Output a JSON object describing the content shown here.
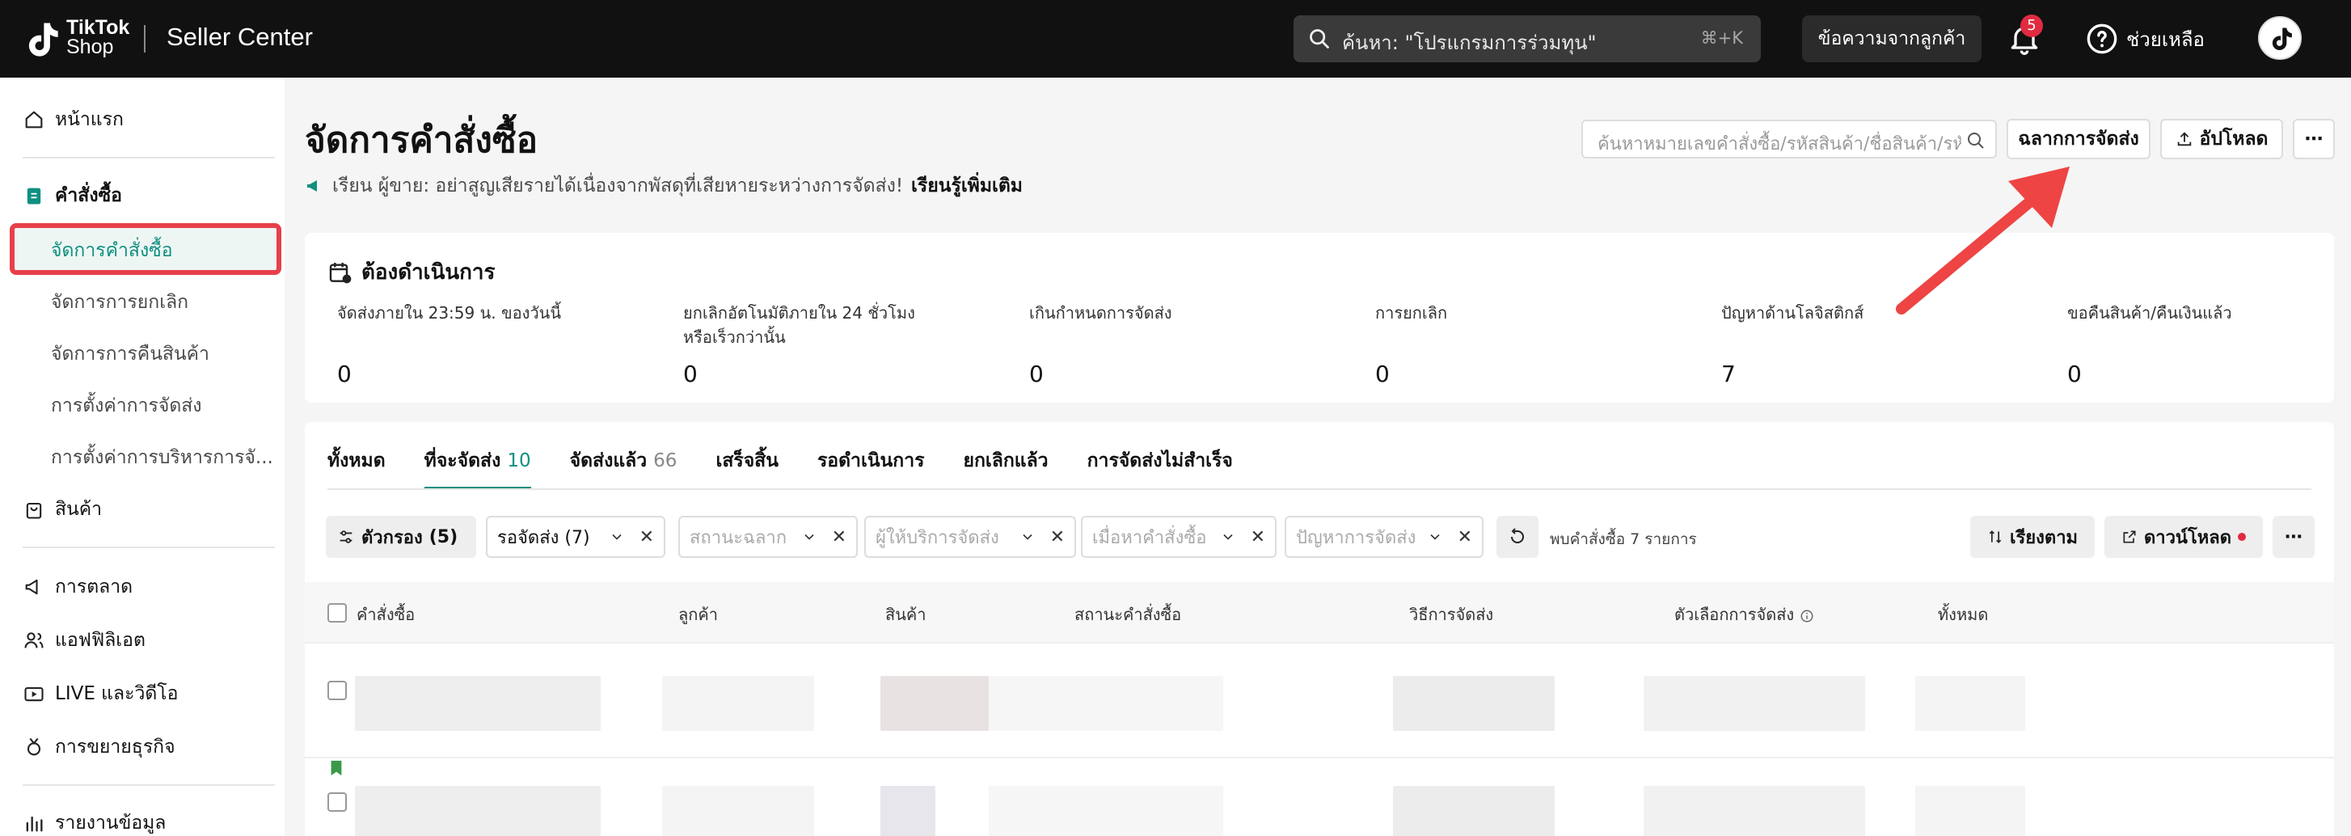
{
  "topbar": {
    "brand_line1": "TikTok",
    "brand_line2": "Shop",
    "app_title": "Seller Center",
    "search_placeholder": "ค้นหา: \"โปรแกรมการร่วมทุน\"",
    "search_shortcut": "⌘+K",
    "messages_label": "ข้อความจากลูกค้า",
    "notification_count": "5",
    "help_label": "ช่วยเหลือ"
  },
  "sidebar": {
    "home": "หน้าแรก",
    "orders": "คำสั่งซื้อ",
    "orders_sub": [
      "จัดการคำสั่งซื้อ",
      "จัดการการยกเลิก",
      "จัดการการคืนสินค้า",
      "การตั้งค่าการจัดส่ง",
      "การตั้งค่าการบริหารการจั..."
    ],
    "products": "สินค้า",
    "marketing": "การตลาด",
    "affiliate": "แอฟฟิลิเอต",
    "live_video": "LIVE และวิดีโอ",
    "growth": "การขยายธุรกิจ",
    "reports": "รายงานข้อมูล"
  },
  "page": {
    "title": "จัดการคำสั่งซื้อ",
    "notice_text": "เรียน ผู้ขาย: อย่าสูญเสียรายได้เนื่องจากพัสดุที่เสียหายระหว่างการจัดส่ง!",
    "notice_link": "เรียนรู้เพิ่มเติม",
    "search_placeholder": "ค้นหาหมายเลขคำสั่งซื้อ/รหัสสินค้า/ชื่อสินค้า/รหัส",
    "btn_labels": "ฉลากการจัดส่ง",
    "btn_upload": "อัปโหลด",
    "btn_more": "⋯"
  },
  "todo": {
    "title": "ต้องดำเนินการ",
    "stats": [
      {
        "label": "จัดส่งภายใน 23:59 น. ของวันนี้",
        "value": "0"
      },
      {
        "label": "ยกเลิกอัตโนมัติภายใน 24 ชั่วโมง หรือเร็วกว่านั้น",
        "value": "0"
      },
      {
        "label": "เกินกำหนดการจัดส่ง",
        "value": "0"
      },
      {
        "label": "การยกเลิก",
        "value": "0"
      },
      {
        "label": "ปัญหาด้านโลจิสติกส์",
        "value": "7"
      },
      {
        "label": "ขอคืนสินค้า/คืนเงินแล้ว",
        "value": "0"
      }
    ]
  },
  "tabs": [
    {
      "label": "ทั้งหมด",
      "count": ""
    },
    {
      "label": "ที่จะจัดส่ง",
      "count": "10"
    },
    {
      "label": "จัดส่งแล้ว",
      "count": "66"
    },
    {
      "label": "เสร็จสิ้น",
      "count": ""
    },
    {
      "label": "รอดำเนินการ",
      "count": ""
    },
    {
      "label": "ยกเลิกแล้ว",
      "count": ""
    },
    {
      "label": "การจัดส่งไม่สำเร็จ",
      "count": ""
    }
  ],
  "filters": {
    "filter_btn": "ตัวกรอง",
    "filter_count": "(5)",
    "awaiting_ship": "รอจัดส่ง (7)",
    "label_status": "สถานะฉลาก",
    "carrier": "ผู้ให้บริการจัดส่ง",
    "order_time": "เมื่อหาคำสั่งซื้อ",
    "problem": "ปัญหาการจัดส่ง",
    "found_text": "พบคำสั่งซื้อ 7 รายการ",
    "sort_btn": "เรียงตาม",
    "download_btn": "ดาวน์โหลด",
    "more_btn": "⋯",
    "clear": "✕"
  },
  "table": {
    "columns": [
      "คำสั่งซื้อ",
      "ลูกค้า",
      "สินค้า",
      "สถานะคำสั่งซื้อ",
      "วิธีการจัดส่ง",
      "ตัวเลือกการจัดส่ง",
      "ทั้งหมด"
    ]
  },
  "colors": {
    "accent": "#0f9080",
    "highlight": "#e8404b",
    "topbar": "#111111"
  }
}
